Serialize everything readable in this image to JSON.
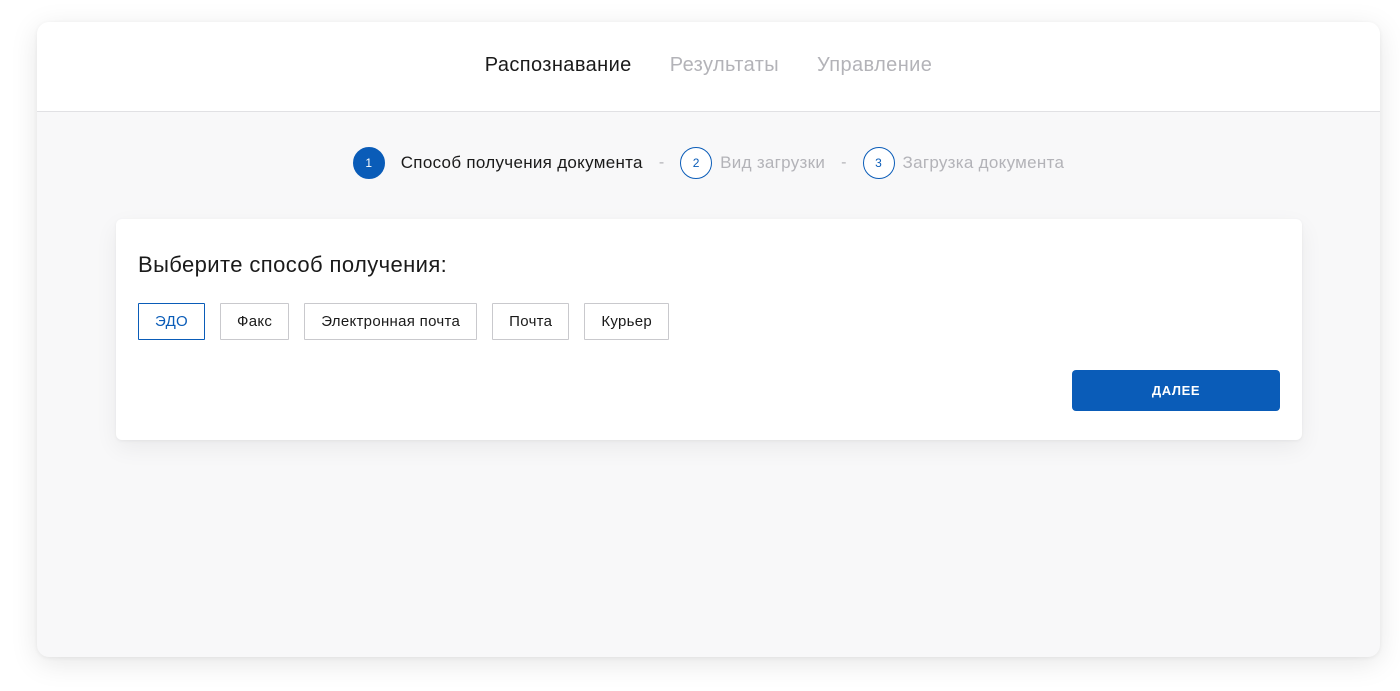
{
  "nav": {
    "tabs": [
      {
        "label": "Распознавание",
        "active": true
      },
      {
        "label": "Результаты",
        "active": false
      },
      {
        "label": "Управление",
        "active": false
      }
    ]
  },
  "stepper": {
    "separator": "-",
    "steps": [
      {
        "number": "1",
        "label": "Способ получения документа",
        "active": true
      },
      {
        "number": "2",
        "label": "Вид загрузки",
        "active": false
      },
      {
        "number": "3",
        "label": "Загрузка документа",
        "active": false
      }
    ]
  },
  "card": {
    "title": "Выберите способ получения:",
    "options": [
      {
        "label": "ЭДО",
        "selected": true
      },
      {
        "label": "Факс",
        "selected": false
      },
      {
        "label": "Электронная почта",
        "selected": false
      },
      {
        "label": "Почта",
        "selected": false
      },
      {
        "label": "Курьер",
        "selected": false
      }
    ],
    "next_label": "ДАЛЕЕ"
  },
  "colors": {
    "accent": "#0a5cb8",
    "text_primary": "#1a1a1a",
    "text_muted": "#b3b3b8",
    "background": "#f8f8f9"
  }
}
